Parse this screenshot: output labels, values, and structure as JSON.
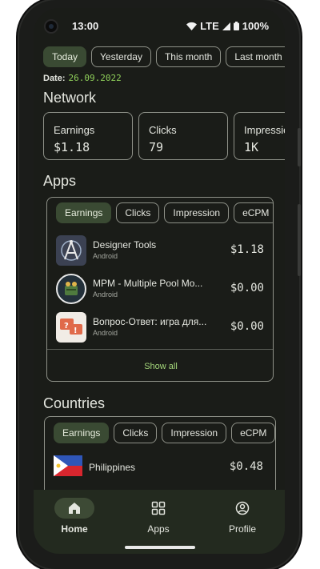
{
  "status_bar": {
    "time": "13:00",
    "network": "LTE",
    "battery": "100%"
  },
  "period_chips": [
    "Today",
    "Yesterday",
    "This month",
    "Last month"
  ],
  "selected_period": "Today",
  "date": {
    "label": "Date:",
    "value": "26.09.2022"
  },
  "network": {
    "title": "Network",
    "cards": [
      {
        "label": "Earnings",
        "value": "$1.18"
      },
      {
        "label": "Clicks",
        "value": "79"
      },
      {
        "label": "Impressio",
        "value": "1K"
      }
    ]
  },
  "apps": {
    "title": "Apps",
    "filters": [
      "Earnings",
      "Clicks",
      "Impression",
      "eCPM"
    ],
    "items": [
      {
        "name": "Designer Tools",
        "platform": "Android",
        "value": "$1.18",
        "icon": "designer-tools-app-icon"
      },
      {
        "name": "MPM - Multiple Pool Mo...",
        "platform": "Android",
        "value": "$0.00",
        "icon": "mpm-app-icon"
      },
      {
        "name": "Вопрос-Ответ: игра для...",
        "platform": "Android",
        "value": "$0.00",
        "icon": "question-answer-app-icon"
      }
    ],
    "show_all": "Show all"
  },
  "countries": {
    "title": "Countries",
    "filters": [
      "Earnings",
      "Clicks",
      "Impression",
      "eCPM"
    ],
    "items": [
      {
        "name": "Philippines",
        "value": "$0.48",
        "flag": "philippines-flag"
      }
    ]
  },
  "bottom_nav": [
    {
      "label": "Home",
      "icon": "home-icon",
      "selected": true
    },
    {
      "label": "Apps",
      "icon": "grid-icon",
      "selected": false
    },
    {
      "label": "Profile",
      "icon": "profile-icon",
      "selected": false
    }
  ],
  "colors": {
    "background": "#1a1c18",
    "accent_green": "#8fcf5a",
    "selected_chip": "#3a4a33",
    "nav_bar": "#232a1f"
  }
}
